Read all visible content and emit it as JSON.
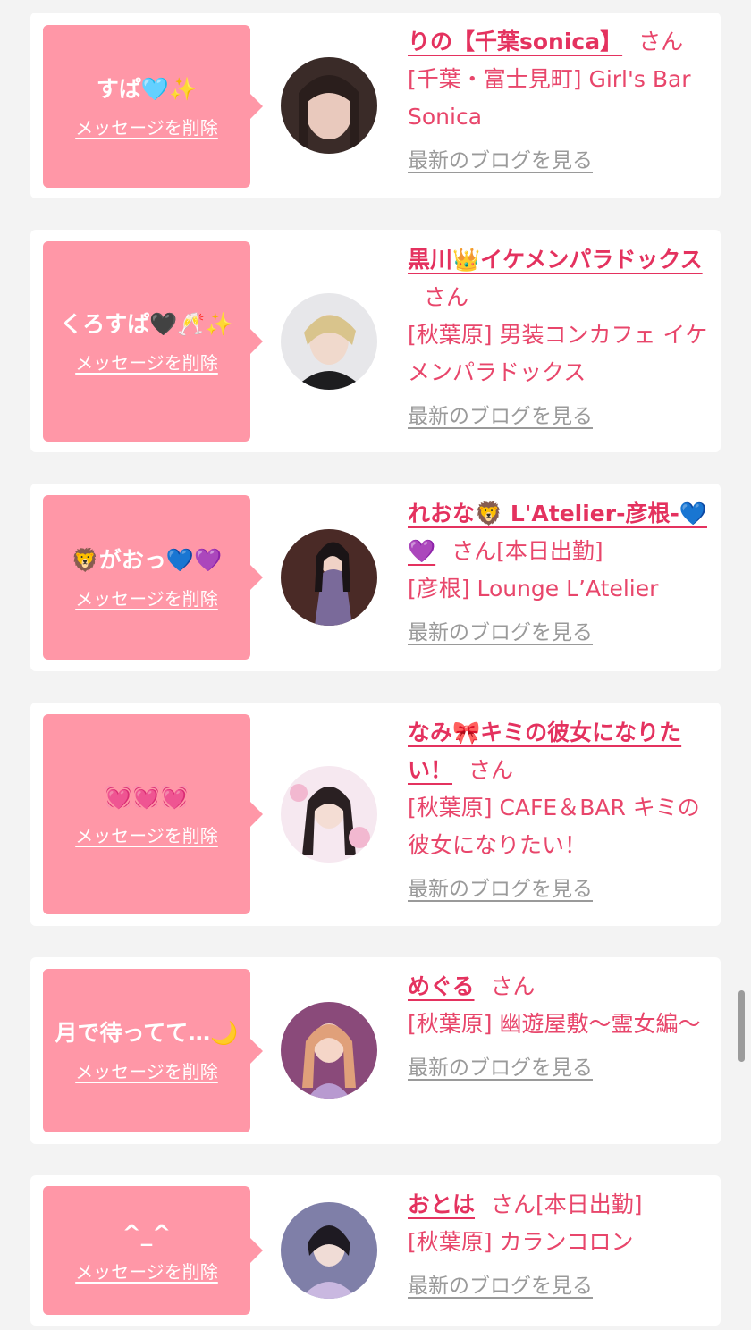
{
  "cards": [
    {
      "message": "すぱ🩵✨",
      "delete_label": "メッセージを削除",
      "name": "りの【千葉sonica】",
      "honorific": "さん",
      "status": "",
      "shop": "[千葉・富士見町] Girl's Bar Sonica",
      "blog_label": "最新のブログを見る",
      "avatar_colors": [
        "#3a2b28",
        "#e9c9bd"
      ]
    },
    {
      "message": "くろすぱ🖤🥂✨",
      "delete_label": "メッセージを削除",
      "name": "黒川👑イケメンパラドックス",
      "honorific": "さん",
      "status": "",
      "shop": "[秋葉原] 男装コンカフェ イケメンパラドックス",
      "blog_label": "最新のブログを見る",
      "avatar_colors": [
        "#e7e7ea",
        "#d9c48c"
      ]
    },
    {
      "message": "🦁がおっ💙💜",
      "delete_label": "メッセージを削除",
      "name": "れおな🦁 L'Atelier-彦根-💙💜",
      "honorific": "さん",
      "status": "[本日出勤]",
      "shop": "[彦根] Lounge L’Atelier",
      "blog_label": "最新のブログを見る",
      "avatar_colors": [
        "#4a2a26",
        "#7a6a9a"
      ]
    },
    {
      "message": "💓💓💓",
      "delete_label": "メッセージを削除",
      "name": "なみ🎀キミの彼女になりたい！",
      "honorific": "さん",
      "status": "",
      "shop": "[秋葉原] CAFE＆BAR キミの彼女になりたい！",
      "blog_label": "最新のブログを見る",
      "avatar_colors": [
        "#f6e8f0",
        "#2a2022"
      ]
    },
    {
      "message": "月で待ってて…🌙",
      "delete_label": "メッセージを削除",
      "name": "めぐる",
      "honorific": "さん",
      "status": "",
      "shop": "[秋葉原] 幽遊屋敷〜霊女編〜",
      "blog_label": "最新のブログを見る",
      "avatar_colors": [
        "#8a4a7a",
        "#e0a07a"
      ]
    },
    {
      "message": "^_^",
      "delete_label": "メッセージを削除",
      "name": "おとは",
      "honorific": "さん",
      "status": "[本日出勤]",
      "shop": "[秋葉原] カランコロン",
      "blog_label": "最新のブログを見る",
      "avatar_colors": [
        "#7f7fa8",
        "#1e1a22"
      ]
    }
  ]
}
